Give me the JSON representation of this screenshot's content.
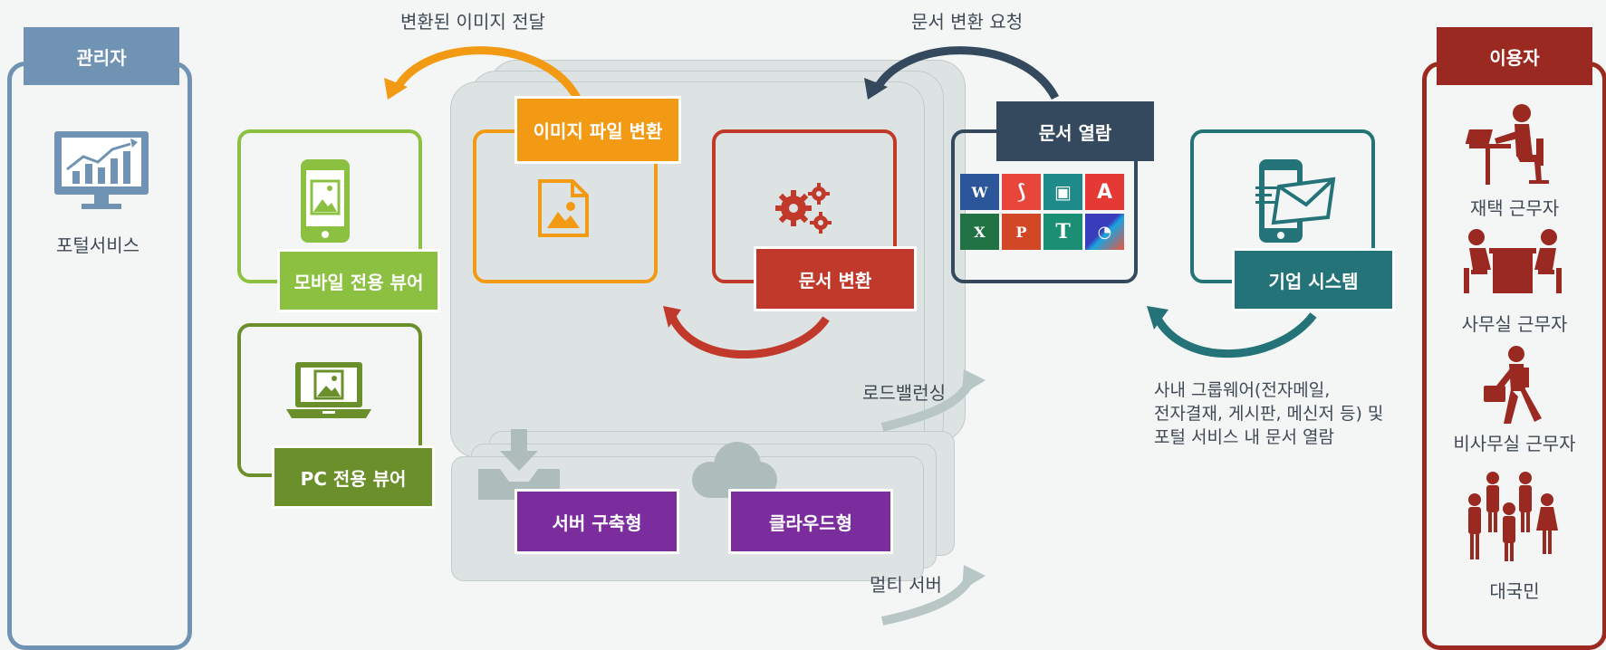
{
  "admin": {
    "header": "관리자",
    "service_label": "포털서비스"
  },
  "user": {
    "header": "이용자",
    "groups": [
      "재택 근무자",
      "사무실 근무자",
      "비사무실 근무자",
      "대국민"
    ]
  },
  "arrows": {
    "delivered_image": "변환된 이미지 전달",
    "convert_request": "문서 변환 요청",
    "load_balancing": "로드밸런싱",
    "multi_server": "멀티 서버"
  },
  "viewers": {
    "mobile": "모바일 전용 뷰어",
    "pc": "PC 전용 뷰어"
  },
  "processes": {
    "image_convert": "이미지 파일 변환",
    "doc_convert": "문서 변환"
  },
  "deploy": {
    "server": "서버 구축형",
    "cloud": "클라우드형"
  },
  "doc_view": {
    "title": "문서 열람"
  },
  "enterprise": {
    "title": "기업 시스템",
    "desc_line1": "사내 그룹웨어(전자메일,",
    "desc_line2": "전자결재, 게시판, 메신저 등) 및",
    "desc_line3": "포털 서비스 내 문서 열람"
  },
  "colors": {
    "admin": "#7093b3",
    "user": "#9a2a21",
    "orange": "#f29a13",
    "red": "#c0392b",
    "navy": "#34495e",
    "teal": "#237378",
    "lightgreen": "#8cc041",
    "darkgreen": "#6a8f2b",
    "purple": "#7b2d9e",
    "grey_box": "#dde3e2"
  }
}
